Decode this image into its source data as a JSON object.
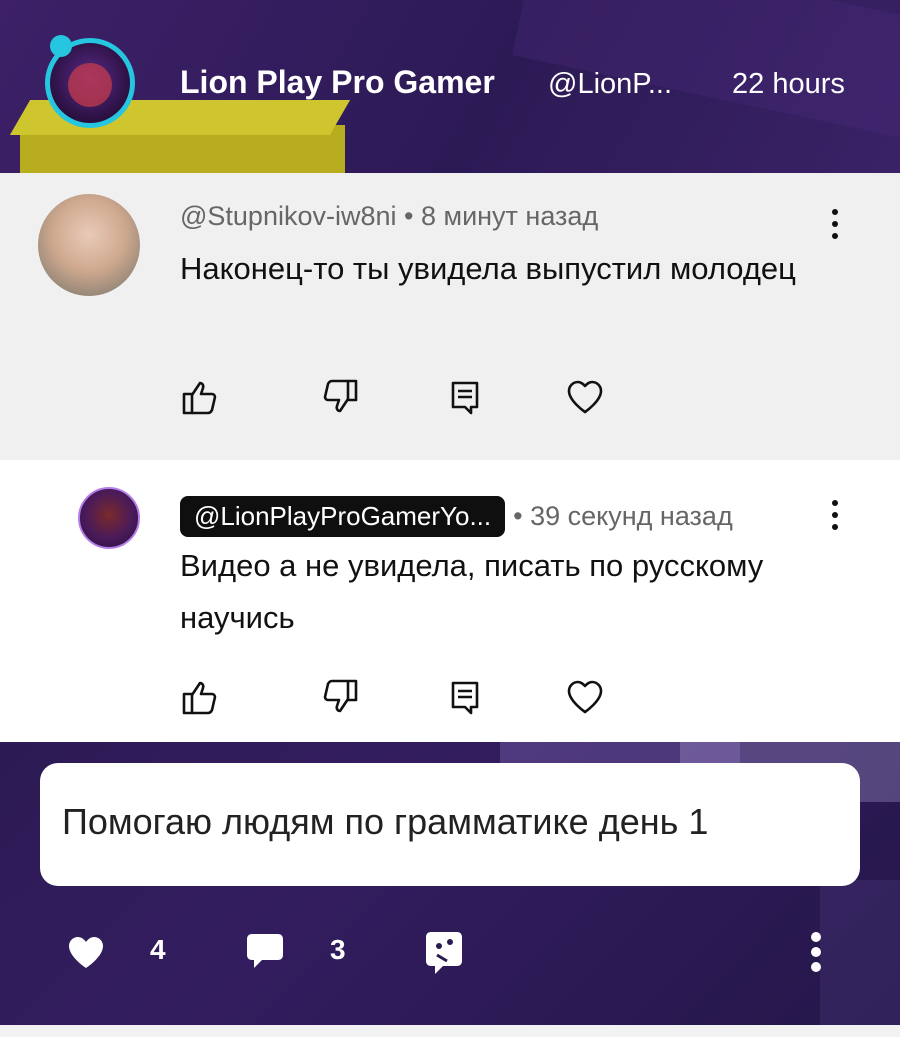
{
  "header": {
    "author_name": "Lion Play Pro Gamer",
    "author_handle": "@LionP...",
    "time": "22 hours"
  },
  "comments": [
    {
      "author": "@Stupnikov-iw8ni",
      "time": "• 8 минут назад",
      "text": "Наконец-то ты увидела выпустил молодец"
    },
    {
      "author": "@LionPlayProGamerYo...",
      "time": "• 39 секунд назад",
      "text": "Видео а не увидела, писать по русскому научись"
    }
  ],
  "caption": "Помогаю людям по грамматике день 1",
  "footer": {
    "likes": "4",
    "comments": "3"
  },
  "icons": {
    "like": "thumbs-up-icon",
    "dislike": "thumbs-down-icon",
    "reply": "reply-icon",
    "heart": "heart-icon",
    "more": "more-vertical-icon"
  },
  "colors": {
    "accent_ring": "#27c6e0",
    "header_bg": "#2c1a55",
    "chip_bg": "#0f0f0f"
  }
}
